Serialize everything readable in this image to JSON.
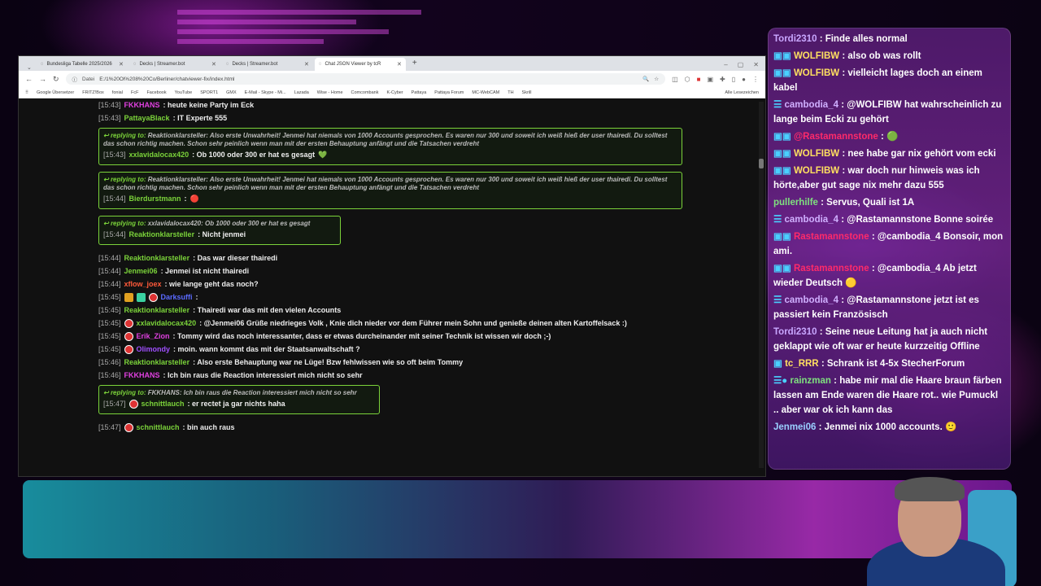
{
  "browser": {
    "tabs": [
      {
        "label": "Bundesliga Tabelle 2025/2026",
        "active": false
      },
      {
        "label": "Decks | Streamer.bot",
        "active": false
      },
      {
        "label": "Decks | Streamer.bot",
        "active": false
      },
      {
        "label": "Chat JSON Viewer by tcR",
        "active": true
      }
    ],
    "url_prefix": "Datei",
    "url": "E:/1%20Ol%208%20Co/Berliner/chatviewer-fix/index.html",
    "bookmarks": [
      "Google Übersetzer",
      "FRITZ!Box",
      "fonial",
      "FcF",
      "Facebook",
      "YouTube",
      "SPORT1",
      "GMX",
      "E-Mail - Skype - Mi...",
      "Lazada",
      "Wise - Home",
      "Comcombank",
      "K-Cyber",
      "Pattaya",
      "Pattaya Forum",
      "MC-WebCAM",
      "TH",
      "Skrill"
    ],
    "bookmarks_right": "Alle Lesezeichen"
  },
  "chat": {
    "lines": [
      {
        "type": "msg",
        "ts": "[15:43]",
        "user": "FKKHANS",
        "color": "#e040e0",
        "text": ": heute keine Party im Eck"
      },
      {
        "type": "msg",
        "ts": "[15:43]",
        "user": "PattayaBlack",
        "color": "#7bd33a",
        "text": ": IT Experte 555"
      },
      {
        "type": "reply",
        "width": 718,
        "replying_label": "replying to:",
        "quote": "Reaktionklarsteller: Also erste Unwahrheit! Jenmei hat niemals von 1000 Accounts gesprochen. Es waren nur 300 und soweit ich weiß hieß der user thairedi. Du solltest das schon richtig machen. Schon sehr peinlich wenn man mit der ersten Behauptung anfängt und die Tatsachen verdreht",
        "ts": "[15:43]",
        "user": "xxlavidalocax420",
        "color": "#7bd33a",
        "text": ": Ob 1000 oder 300 er hat es gesagt",
        "emote": "💚"
      },
      {
        "type": "reply",
        "width": 718,
        "replying_label": "replying to:",
        "quote": "Reaktionklarsteller: Also erste Unwahrheit! Jenmei hat niemals von 1000 Accounts gesprochen. Es waren nur 300 und soweit ich weiß hieß der user thairedi. Du solltest das schon richtig machen. Schon sehr peinlich wenn man mit der ersten Behauptung anfängt und die Tatsachen verdreht",
        "ts": "[15:44]",
        "user": "Bierdurstmann",
        "color": "#7bd33a",
        "text": ":",
        "emote": "🔴"
      },
      {
        "type": "reply",
        "width": 298,
        "replying_label": "replying to:",
        "quote": "xxlavidalocax420: Ob 1000 oder 300 er hat es gesagt",
        "ts": "[15:44]",
        "user": "Reaktionklarsteller",
        "color": "#7bd33a",
        "text": ": Nicht jenmei",
        "emote": ""
      },
      {
        "type": "msg",
        "ts": "[15:44]",
        "user": "Reaktionklarsteller",
        "color": "#7bd33a",
        "text": ": Das war dieser thairedi"
      },
      {
        "type": "msg",
        "ts": "[15:44]",
        "user": "Jenmei06",
        "color": "#7bd33a",
        "text": ": Jenmei ist nicht thairedi"
      },
      {
        "type": "msg",
        "ts": "[15:44]",
        "user": "xflow_joex",
        "color": "#ff5a3a",
        "text": ": wie lange geht das noch?"
      },
      {
        "type": "msg",
        "ts": "[15:45]",
        "user": "Darksuffi",
        "color": "#5a6aff",
        "text": ":",
        "badges": 3
      },
      {
        "type": "msg",
        "ts": "[15:45]",
        "user": "Reaktionklarsteller",
        "color": "#7bd33a",
        "text": ": Thairedi war das mit den vielen Accounts"
      },
      {
        "type": "msg",
        "ts": "[15:45]",
        "user": "xxlavidalocax420",
        "color": "#7bd33a",
        "text": ": @Jenmei06 Grüße niedrieges Volk , Knie dich nieder vor dem Führer mein Sohn und genieße deinen alten Kartoffelsack :)",
        "badges": 1
      },
      {
        "type": "msg",
        "ts": "[15:45]",
        "user": "Erik_Zion",
        "color": "#e040e0",
        "text": ": Tommy wird das noch interessanter, dass er etwas durcheinander mit seiner Technik ist wissen wir doch ;-)",
        "badges": 1
      },
      {
        "type": "msg",
        "ts": "[15:45]",
        "user": "Olimondy",
        "color": "#a050ff",
        "text": ": moin. wann kommt das mit der Staatsanwaltschaft ?",
        "badges": 1
      },
      {
        "type": "msg",
        "ts": "[15:46]",
        "user": "Reaktionklarsteller",
        "color": "#7bd33a",
        "text": ": Also erste Behauptung war ne Lüge! Bzw fehlwissen wie so oft beim Tommy"
      },
      {
        "type": "msg",
        "ts": "[15:46]",
        "user": "FKKHANS",
        "color": "#e040e0",
        "text": ": Ich bin raus die Reaction interessiert mich nicht so sehr"
      },
      {
        "type": "reply",
        "width": 346,
        "replying_label": "replying to:",
        "quote": "FKKHANS: Ich bin raus die Reaction interessiert mich nicht so sehr",
        "ts": "[15:47]",
        "user": "schnittlauch",
        "color": "#7bd33a",
        "text": ": er rectet ja gar nichts haha",
        "emote": "",
        "badges": 1
      },
      {
        "type": "msg",
        "ts": "[15:47]",
        "user": "schnittlauch",
        "color": "#7bd33a",
        "text": ": bin auch raus",
        "badges": 1
      }
    ]
  },
  "overlay": {
    "lines": [
      {
        "user": "Tordi2310",
        "color": "#c9a7ff",
        "text": ": Finde alles normal",
        "icons": ""
      },
      {
        "user": "WOLFIBW",
        "color": "#ffe060",
        "text": ": also ob was rollt",
        "icons": "▣▣"
      },
      {
        "user": "WOLFIBW",
        "color": "#ffe060",
        "text": ": vielleicht lages doch an einem kabel",
        "icons": "▣▣"
      },
      {
        "user": "cambodia_4",
        "color": "#d0b0ff",
        "text": ": @WOLFIBW hat wahrscheinlich zu lange beim Ecki zu gehört",
        "icons": "☰"
      },
      {
        "user": "@Rastamannstone",
        "color": "#ff2a6a",
        "text": ":",
        "icons": "▣▣",
        "emote": "🟢"
      },
      {
        "user": "WOLFIBW",
        "color": "#ffe060",
        "text": ": nee habe gar nix gehört vom ecki",
        "icons": "▣▣"
      },
      {
        "user": "WOLFIBW",
        "color": "#ffe060",
        "text": ": war doch nur hinweis was ich hörte,aber gut sage nix mehr dazu 555",
        "icons": "▣▣"
      },
      {
        "user": "pullerhilfe",
        "color": "#7fe07f",
        "text": ": Servus, Quali ist 1A",
        "icons": ""
      },
      {
        "user": "cambodia_4",
        "color": "#d0b0ff",
        "text": ": @Rastamannstone Bonne soirée",
        "icons": "☰"
      },
      {
        "user": "Rastamannstone",
        "color": "#ff2a6a",
        "text": ": @cambodia_4 Bonsoir, mon ami.",
        "icons": "▣▣"
      },
      {
        "user": "Rastamannstone",
        "color": "#ff2a6a",
        "text": ": @cambodia_4 Ab jetzt wieder Deutsch",
        "icons": "▣▣",
        "emote": "🟡"
      },
      {
        "user": "cambodia_4",
        "color": "#d0b0ff",
        "text": ": @Rastamannstone jetzt ist es passiert kein Französisch",
        "icons": "☰"
      },
      {
        "user": "Tordi2310",
        "color": "#c9a7ff",
        "text": ": Seine neue Leitung hat ja auch nicht geklappt wie oft war er heute kurzzeitig Offline",
        "icons": ""
      },
      {
        "user": "tc_RRR",
        "color": "#ffe060",
        "text": ": Schrank ist 4-5x StecherForum",
        "icons": "▣"
      },
      {
        "user": "rainzman",
        "color": "#7fe07f",
        "text": ": habe mir mal die Haare braun färben lassen am Ende waren die Haare rot.. wie Pumuckl .. aber war ok ich kann das",
        "icons": "☰●"
      },
      {
        "user": "Jenmei06",
        "color": "#9ad0ff",
        "text": ": Jenmei nix 1000 accounts.",
        "icons": "",
        "emote": "🙂"
      }
    ]
  }
}
